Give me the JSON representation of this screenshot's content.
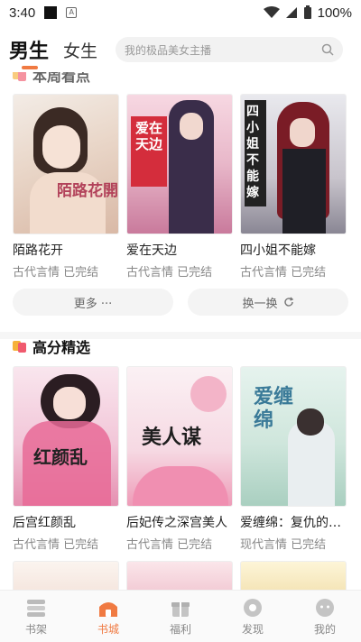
{
  "status": {
    "time": "3:40",
    "battery": "100%"
  },
  "header": {
    "tabs": [
      {
        "label": "男生"
      },
      {
        "label": "女生"
      }
    ],
    "search_placeholder": "我的极品美女主播"
  },
  "section1": {
    "title": "本周看点",
    "books": [
      {
        "title": "陌路花开",
        "meta": "古代言情 已完结",
        "cover_text": "陌路花開"
      },
      {
        "title": "爱在天边",
        "meta": "古代言情 已完结",
        "cover_text": "爱在天边"
      },
      {
        "title": "四小姐不能嫁",
        "meta": "古代言情 已完结",
        "cover_text": "四小姐不能嫁"
      }
    ],
    "more_label": "更多 ···",
    "refresh_label": "换一换"
  },
  "section2": {
    "title": "高分精选",
    "books": [
      {
        "title": "后宫红颜乱",
        "meta": "古代言情 已完结",
        "cover_text": "红颜乱"
      },
      {
        "title": "后妃传之深宫美人",
        "meta": "古代言情 已完结",
        "cover_text": "美人谋"
      },
      {
        "title": "爱缠绵：复仇的女人",
        "meta": "现代言情 已完结",
        "cover_text": "爱缠绵"
      }
    ]
  },
  "nav": {
    "items": [
      {
        "label": "书架",
        "icon": "bookshelf-icon"
      },
      {
        "label": "书城",
        "icon": "bookstore-icon"
      },
      {
        "label": "福利",
        "icon": "gift-icon"
      },
      {
        "label": "发现",
        "icon": "discover-icon"
      },
      {
        "label": "我的",
        "icon": "profile-icon"
      }
    ],
    "active_index": 1
  },
  "colors": {
    "accent": "#f07a42",
    "muted": "#888888"
  }
}
